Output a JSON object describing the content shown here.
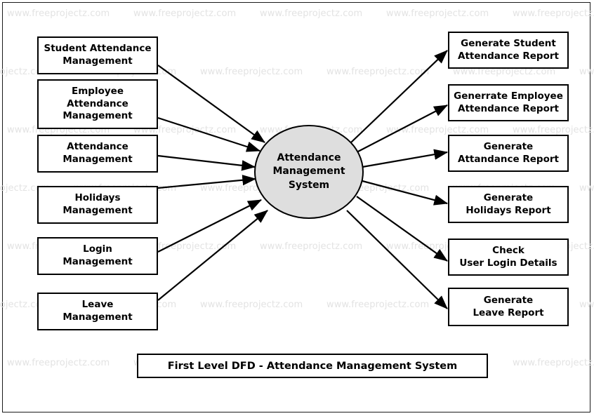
{
  "diagram": {
    "type": "data-flow-diagram",
    "caption": "First Level DFD - Attendance Management System",
    "process": {
      "label": "Attendance\nManagement\nSystem",
      "fill_color": "#dedede",
      "stroke_color": "#000000"
    },
    "inputs": [
      {
        "id": "student-attendance-management",
        "label": "Student Attendance\nManagement"
      },
      {
        "id": "employee-attendance-management",
        "label": "Employee\nAttendance\nManagement"
      },
      {
        "id": "attendance-management",
        "label": "Attendance\nManagement"
      },
      {
        "id": "holidays-management",
        "label": "Holidays\nManagement"
      },
      {
        "id": "login-management",
        "label": "Login\nManagement"
      },
      {
        "id": "leave-management",
        "label": "Leave\nManagement"
      }
    ],
    "outputs": [
      {
        "id": "generate-student-attendance-report",
        "label": "Generate Student\nAttendance Report"
      },
      {
        "id": "generate-employee-attendance-report",
        "label": "Generrate Employee\nAttendance Report"
      },
      {
        "id": "generate-attendance-report",
        "label": "Generate\nAttandance Report"
      },
      {
        "id": "generate-holidays-report",
        "label": "Generate\nHolidays Report"
      },
      {
        "id": "check-user-login-details",
        "label": "Check\nUser Login Details"
      },
      {
        "id": "generate-leave-report",
        "label": "Generate\nLeave Report"
      }
    ]
  },
  "watermark": {
    "text": "www.freeprojectz.com",
    "color": "#e3e3e3"
  }
}
